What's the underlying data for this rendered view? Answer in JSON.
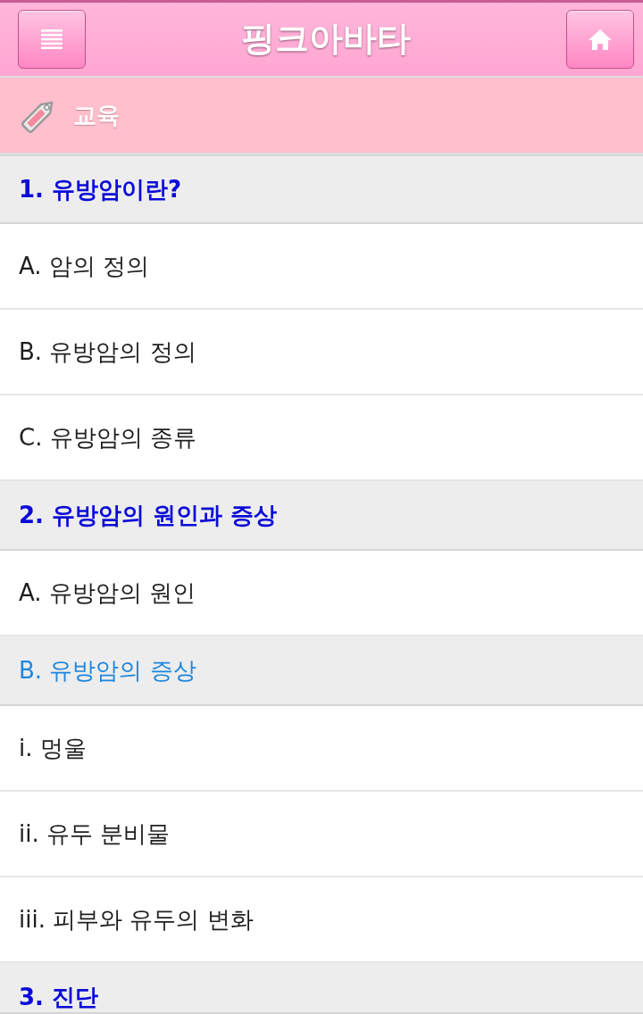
{
  "header": {
    "title": "핑크아바타"
  },
  "category": {
    "label": "교육"
  },
  "sections": [
    {
      "title": "1. 유방암이란?",
      "children": [
        {
          "label": "A. 암의 정의"
        },
        {
          "label": "B. 유방암의 정의"
        },
        {
          "label": "C. 유방암의 종류"
        }
      ]
    },
    {
      "title": "2. 유방암의 원인과 증상",
      "children": [
        {
          "label": "A. 유방암의 원인"
        },
        {
          "label": "B. 유방암의 증상",
          "children": [
            {
              "label": "i. 멍울"
            },
            {
              "label": "ii. 유두 분비물"
            },
            {
              "label": "iii. 피부와 유두의 변화"
            }
          ]
        }
      ]
    },
    {
      "title": "3. 진단"
    }
  ]
}
